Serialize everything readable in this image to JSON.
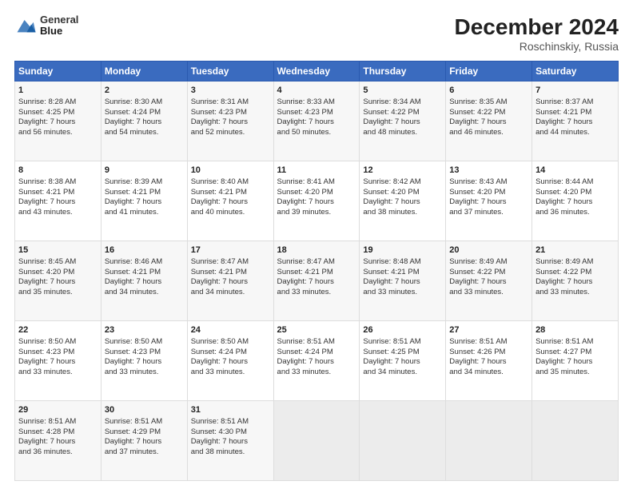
{
  "header": {
    "logo_line1": "General",
    "logo_line2": "Blue",
    "month": "December 2024",
    "location": "Roschinskiy, Russia"
  },
  "weekdays": [
    "Sunday",
    "Monday",
    "Tuesday",
    "Wednesday",
    "Thursday",
    "Friday",
    "Saturday"
  ],
  "weeks": [
    [
      {
        "day": "1",
        "lines": [
          "Sunrise: 8:28 AM",
          "Sunset: 4:25 PM",
          "Daylight: 7 hours",
          "and 56 minutes."
        ]
      },
      {
        "day": "2",
        "lines": [
          "Sunrise: 8:30 AM",
          "Sunset: 4:24 PM",
          "Daylight: 7 hours",
          "and 54 minutes."
        ]
      },
      {
        "day": "3",
        "lines": [
          "Sunrise: 8:31 AM",
          "Sunset: 4:23 PM",
          "Daylight: 7 hours",
          "and 52 minutes."
        ]
      },
      {
        "day": "4",
        "lines": [
          "Sunrise: 8:33 AM",
          "Sunset: 4:23 PM",
          "Daylight: 7 hours",
          "and 50 minutes."
        ]
      },
      {
        "day": "5",
        "lines": [
          "Sunrise: 8:34 AM",
          "Sunset: 4:22 PM",
          "Daylight: 7 hours",
          "and 48 minutes."
        ]
      },
      {
        "day": "6",
        "lines": [
          "Sunrise: 8:35 AM",
          "Sunset: 4:22 PM",
          "Daylight: 7 hours",
          "and 46 minutes."
        ]
      },
      {
        "day": "7",
        "lines": [
          "Sunrise: 8:37 AM",
          "Sunset: 4:21 PM",
          "Daylight: 7 hours",
          "and 44 minutes."
        ]
      }
    ],
    [
      {
        "day": "8",
        "lines": [
          "Sunrise: 8:38 AM",
          "Sunset: 4:21 PM",
          "Daylight: 7 hours",
          "and 43 minutes."
        ]
      },
      {
        "day": "9",
        "lines": [
          "Sunrise: 8:39 AM",
          "Sunset: 4:21 PM",
          "Daylight: 7 hours",
          "and 41 minutes."
        ]
      },
      {
        "day": "10",
        "lines": [
          "Sunrise: 8:40 AM",
          "Sunset: 4:21 PM",
          "Daylight: 7 hours",
          "and 40 minutes."
        ]
      },
      {
        "day": "11",
        "lines": [
          "Sunrise: 8:41 AM",
          "Sunset: 4:20 PM",
          "Daylight: 7 hours",
          "and 39 minutes."
        ]
      },
      {
        "day": "12",
        "lines": [
          "Sunrise: 8:42 AM",
          "Sunset: 4:20 PM",
          "Daylight: 7 hours",
          "and 38 minutes."
        ]
      },
      {
        "day": "13",
        "lines": [
          "Sunrise: 8:43 AM",
          "Sunset: 4:20 PM",
          "Daylight: 7 hours",
          "and 37 minutes."
        ]
      },
      {
        "day": "14",
        "lines": [
          "Sunrise: 8:44 AM",
          "Sunset: 4:20 PM",
          "Daylight: 7 hours",
          "and 36 minutes."
        ]
      }
    ],
    [
      {
        "day": "15",
        "lines": [
          "Sunrise: 8:45 AM",
          "Sunset: 4:20 PM",
          "Daylight: 7 hours",
          "and 35 minutes."
        ]
      },
      {
        "day": "16",
        "lines": [
          "Sunrise: 8:46 AM",
          "Sunset: 4:21 PM",
          "Daylight: 7 hours",
          "and 34 minutes."
        ]
      },
      {
        "day": "17",
        "lines": [
          "Sunrise: 8:47 AM",
          "Sunset: 4:21 PM",
          "Daylight: 7 hours",
          "and 34 minutes."
        ]
      },
      {
        "day": "18",
        "lines": [
          "Sunrise: 8:47 AM",
          "Sunset: 4:21 PM",
          "Daylight: 7 hours",
          "and 33 minutes."
        ]
      },
      {
        "day": "19",
        "lines": [
          "Sunrise: 8:48 AM",
          "Sunset: 4:21 PM",
          "Daylight: 7 hours",
          "and 33 minutes."
        ]
      },
      {
        "day": "20",
        "lines": [
          "Sunrise: 8:49 AM",
          "Sunset: 4:22 PM",
          "Daylight: 7 hours",
          "and 33 minutes."
        ]
      },
      {
        "day": "21",
        "lines": [
          "Sunrise: 8:49 AM",
          "Sunset: 4:22 PM",
          "Daylight: 7 hours",
          "and 33 minutes."
        ]
      }
    ],
    [
      {
        "day": "22",
        "lines": [
          "Sunrise: 8:50 AM",
          "Sunset: 4:23 PM",
          "Daylight: 7 hours",
          "and 33 minutes."
        ]
      },
      {
        "day": "23",
        "lines": [
          "Sunrise: 8:50 AM",
          "Sunset: 4:23 PM",
          "Daylight: 7 hours",
          "and 33 minutes."
        ]
      },
      {
        "day": "24",
        "lines": [
          "Sunrise: 8:50 AM",
          "Sunset: 4:24 PM",
          "Daylight: 7 hours",
          "and 33 minutes."
        ]
      },
      {
        "day": "25",
        "lines": [
          "Sunrise: 8:51 AM",
          "Sunset: 4:24 PM",
          "Daylight: 7 hours",
          "and 33 minutes."
        ]
      },
      {
        "day": "26",
        "lines": [
          "Sunrise: 8:51 AM",
          "Sunset: 4:25 PM",
          "Daylight: 7 hours",
          "and 34 minutes."
        ]
      },
      {
        "day": "27",
        "lines": [
          "Sunrise: 8:51 AM",
          "Sunset: 4:26 PM",
          "Daylight: 7 hours",
          "and 34 minutes."
        ]
      },
      {
        "day": "28",
        "lines": [
          "Sunrise: 8:51 AM",
          "Sunset: 4:27 PM",
          "Daylight: 7 hours",
          "and 35 minutes."
        ]
      }
    ],
    [
      {
        "day": "29",
        "lines": [
          "Sunrise: 8:51 AM",
          "Sunset: 4:28 PM",
          "Daylight: 7 hours",
          "and 36 minutes."
        ]
      },
      {
        "day": "30",
        "lines": [
          "Sunrise: 8:51 AM",
          "Sunset: 4:29 PM",
          "Daylight: 7 hours",
          "and 37 minutes."
        ]
      },
      {
        "day": "31",
        "lines": [
          "Sunrise: 8:51 AM",
          "Sunset: 4:30 PM",
          "Daylight: 7 hours",
          "and 38 minutes."
        ]
      },
      null,
      null,
      null,
      null
    ]
  ]
}
